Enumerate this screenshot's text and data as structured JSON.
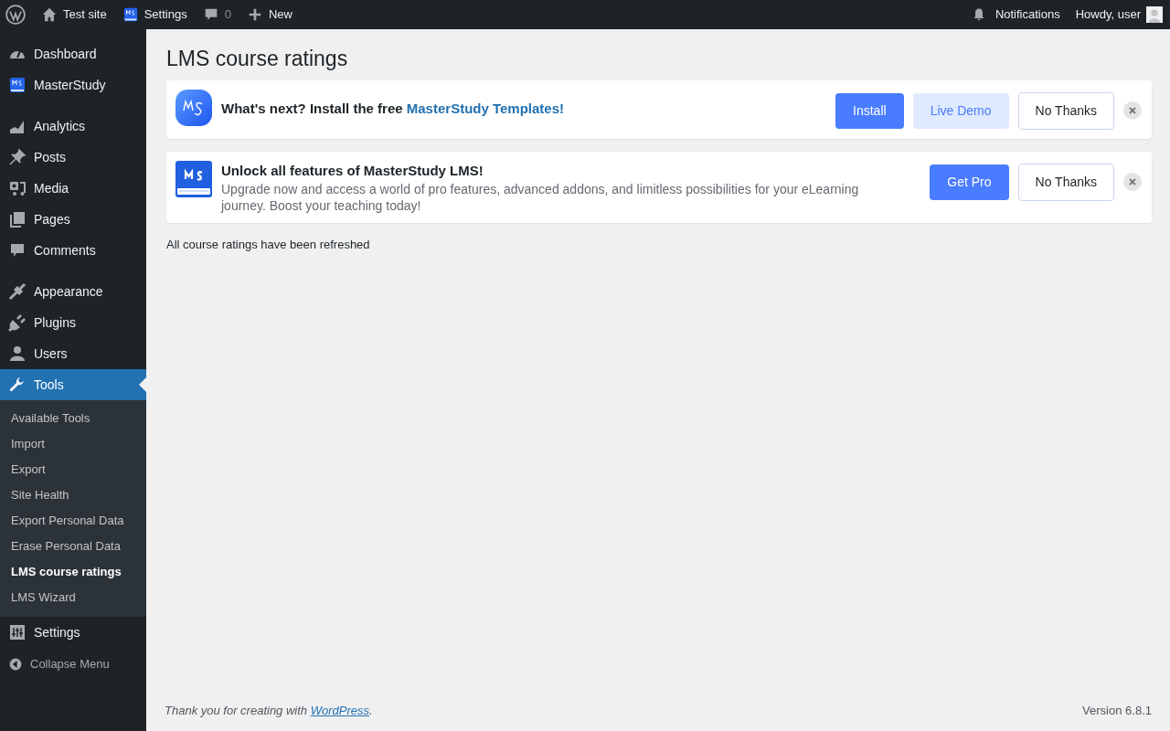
{
  "admin_bar": {
    "left": [
      {
        "kind": "wp"
      },
      {
        "kind": "home",
        "label": "Test site"
      },
      {
        "kind": "ms",
        "label": "Settings"
      },
      {
        "kind": "comment",
        "label": "0"
      },
      {
        "kind": "plus",
        "label": "New"
      }
    ],
    "right": [
      {
        "kind": "bell",
        "label": "Notifications"
      },
      {
        "kind": "avatar",
        "label": "Howdy, user"
      }
    ]
  },
  "sidebar": {
    "groups": [
      {
        "items": [
          {
            "kind": "dashboard",
            "label": "Dashboard",
            "selected": false
          },
          {
            "kind": "ms",
            "label": "MasterStudy",
            "selected": false
          }
        ]
      },
      {
        "items": [
          {
            "kind": "analytics",
            "label": "Analytics",
            "selected": false
          },
          {
            "kind": "pin",
            "label": "Posts",
            "selected": false
          },
          {
            "kind": "media",
            "label": "Media",
            "selected": false
          },
          {
            "kind": "pages",
            "label": "Pages",
            "selected": false
          },
          {
            "kind": "comment",
            "label": "Comments",
            "selected": false
          }
        ]
      },
      {
        "items": [
          {
            "kind": "brush",
            "label": "Appearance",
            "selected": false
          },
          {
            "kind": "plug",
            "label": "Plugins",
            "selected": false
          },
          {
            "kind": "user",
            "label": "Users",
            "selected": false
          },
          {
            "kind": "wrench",
            "label": "Tools",
            "selected": true,
            "children": [
              {
                "label": "Available Tools",
                "selected": false
              },
              {
                "label": "Import",
                "selected": false
              },
              {
                "label": "Export",
                "selected": false
              },
              {
                "label": "Site Health",
                "selected": false
              },
              {
                "label": "Export Personal Data",
                "selected": false
              },
              {
                "label": "Erase Personal Data",
                "selected": false
              },
              {
                "label": "LMS course ratings",
                "selected": true
              },
              {
                "label": "LMS Wizard",
                "selected": false
              }
            ]
          },
          {
            "kind": "settings",
            "label": "Settings",
            "selected": false
          }
        ]
      }
    ],
    "collapse": "Collapse Menu"
  },
  "page_title": "LMS course ratings",
  "notices": [
    {
      "kind": "templates",
      "title": "What's next? Install the free ",
      "title_link": "MasterStudy Templates!",
      "buttons": [
        {
          "kind": "primary",
          "label": "Install"
        },
        {
          "kind": "light",
          "label": "Live Demo"
        },
        {
          "kind": "outline",
          "label": "No Thanks"
        }
      ]
    },
    {
      "kind": "pro",
      "title": "Unlock all features of MasterStudy LMS!",
      "text": "Upgrade now and access a world of pro features, advanced addons, and limitless possibilities for your eLearning journey. Boost your teaching today!",
      "buttons": [
        {
          "kind": "primary",
          "label": "Get Pro"
        },
        {
          "kind": "outline",
          "label": "No Thanks"
        }
      ]
    }
  ],
  "message": "All course ratings have been refreshed",
  "footer": {
    "text": "Thank you for creating with ",
    "link": "WordPress",
    "after": ".",
    "version": "Version 6.8.1"
  }
}
